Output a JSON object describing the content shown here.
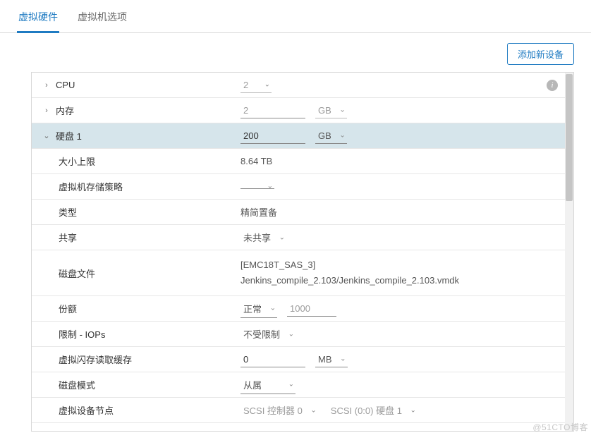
{
  "tabs": {
    "hardware": "虚拟硬件",
    "options": "虚拟机选项"
  },
  "toolbar": {
    "add_device": "添加新设备"
  },
  "rows": {
    "cpu": {
      "label": "CPU",
      "value": "2"
    },
    "memory": {
      "label": "内存",
      "value": "2",
      "unit": "GB"
    },
    "disk": {
      "label": "硬盘 1",
      "value": "200",
      "unit": "GB"
    },
    "max_size": {
      "label": "大小上限",
      "value": "8.64 TB"
    },
    "storage_policy": {
      "label": "虚拟机存储策略",
      "value": ""
    },
    "type": {
      "label": "类型",
      "value": "精简置备"
    },
    "sharing": {
      "label": "共享",
      "value": "未共享"
    },
    "disk_file": {
      "label": "磁盘文件",
      "line1": "[EMC18T_SAS_3]",
      "line2": "Jenkins_compile_2.103/Jenkins_compile_2.103.vmdk"
    },
    "shares": {
      "label": "份额",
      "level": "正常",
      "value": "1000"
    },
    "limit_iops": {
      "label": "限制 - IOPs",
      "value": "不受限制"
    },
    "flash_cache": {
      "label": "虚拟闪存读取缓存",
      "value": "0",
      "unit": "MB"
    },
    "disk_mode": {
      "label": "磁盘模式",
      "value": "从属"
    },
    "device_node": {
      "label": "虚拟设备节点",
      "controller": "SCSI 控制器 0",
      "slot": "SCSI (0:0) 硬盘 1"
    }
  },
  "watermark": "@51CTO博客"
}
